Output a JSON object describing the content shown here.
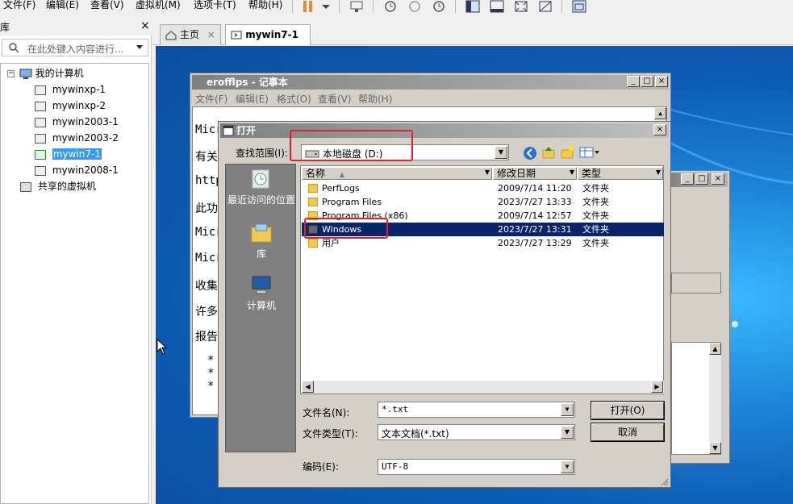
{
  "menubar": {
    "items": [
      "文件(F)",
      "编辑(E)",
      "查看(V)",
      "虚拟机(M)",
      "选项卡(T)",
      "帮助(H)"
    ]
  },
  "library": {
    "title": "库",
    "close": "×",
    "search_placeholder": "在此处键入内容进行...",
    "tree": [
      {
        "label": "我的计算机",
        "selected": false
      },
      {
        "label": "mywinxp-1",
        "selected": false
      },
      {
        "label": "mywinxp-2",
        "selected": false
      },
      {
        "label": "mywin2003-1",
        "selected": false
      },
      {
        "label": "mywin2003-2",
        "selected": false
      },
      {
        "label": "mywin7-1",
        "selected": true
      },
      {
        "label": "mywin2008-1",
        "selected": false
      },
      {
        "label": "共享的虚拟机",
        "selected": false
      }
    ]
  },
  "tabs": [
    {
      "label": "主页",
      "close": "×",
      "active": false
    },
    {
      "label": "mywin7-1",
      "close": "×",
      "active": true
    }
  ],
  "notepad": {
    "title": "erofflps - 记事本",
    "menu": [
      "文件(F)",
      "编辑(E)",
      "格式(O)",
      "查看(V)",
      "帮助(H)"
    ],
    "lines": [
      "Micr",
      "有关",
      "http",
      "此功",
      "Micr",
      "Micr",
      "收集",
      "许多",
      "报告"
    ],
    "bullets": [
      "*",
      "*",
      "*"
    ]
  },
  "dialog": {
    "title": "打开",
    "lookin_label": "查找范围(I):",
    "lookin_value": "本地磁盘 (D:)",
    "places": [
      "最近访问的位置",
      "库",
      "计算机"
    ],
    "columns": [
      "名称",
      "修改日期",
      "类型"
    ],
    "files": [
      {
        "name": "PerfLogs",
        "date": "2009/7/14 11:20",
        "type": "文件夹",
        "selected": false
      },
      {
        "name": "Program Files",
        "date": "2023/7/27 13:33",
        "type": "文件夹",
        "selected": false
      },
      {
        "name": "Program Files (x86)",
        "date": "2009/7/14 12:57",
        "type": "文件夹",
        "selected": false
      },
      {
        "name": "Windows",
        "date": "2023/7/27 13:31",
        "type": "文件夹",
        "selected": true
      },
      {
        "name": "用户",
        "date": "2023/7/27 13:29",
        "type": "文件夹",
        "selected": false
      }
    ],
    "filename_label": "文件名(N):",
    "filename_value": "*.txt",
    "filetype_label": "文件类型(T):",
    "filetype_value": "文本文档(*.txt)",
    "encoding_label": "编码(E):",
    "encoding_value": "UTF-8",
    "open_button": "打开(O)",
    "cancel_button": "取消"
  },
  "colors": {
    "highlight": "#0a246a",
    "annotation_red": "#e0202a",
    "tree_selected": "#3399ff"
  }
}
